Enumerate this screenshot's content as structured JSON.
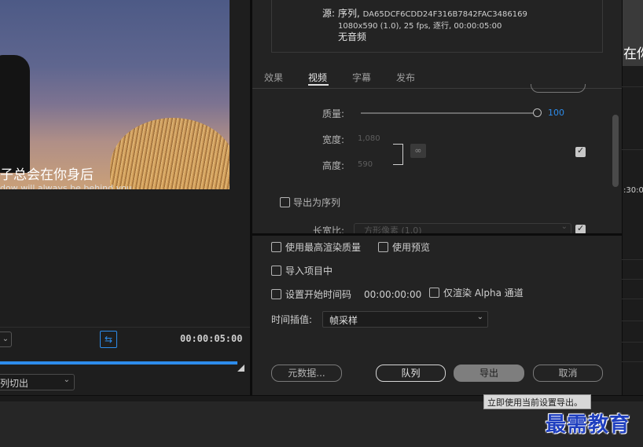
{
  "left_panel": {
    "subtitle_cn": "子总会在你身后",
    "subtitle_en": "dow will always be behind you",
    "duration": "00:00:05:00",
    "crop_dropdown": "列切出"
  },
  "source": {
    "label": "源:",
    "name_prefix": "序列,",
    "name_id": "DA65DCF6CDD24F316B7842FAC3486169",
    "details": "1080x590 (1.0), 25 fps, 逐行, 00:00:05:00",
    "audio": "无音频"
  },
  "tabs": [
    "效果",
    "视频",
    "字幕",
    "发布"
  ],
  "active_tab": "视频",
  "video": {
    "quality_label": "质量:",
    "quality_value": "100",
    "width_label": "宽度:",
    "width_value": "1,080",
    "height_label": "高度:",
    "height_value": "590",
    "export_sequence": "导出为序列",
    "aspect_label": "长宽比:",
    "aspect_value": "方形像素 (1.0)"
  },
  "options": {
    "max_render_quality": "使用最高渲染质量",
    "use_previews": "使用预览",
    "import_into_project": "导入项目中",
    "set_start_timecode": "设置开始时间码",
    "start_timecode_value": "00:00:00:00",
    "render_alpha_only": "仅渲染 Alpha 通道",
    "time_interp_label": "时间插值:",
    "time_interp_value": "帧采样"
  },
  "buttons": {
    "metadata": "元数据...",
    "queue": "队列",
    "export": "导出",
    "cancel": "取消"
  },
  "tooltip": "立即使用当前设置导出。",
  "far_right": {
    "text": "在你",
    "time": ":30:0"
  },
  "watermark": "最需教育",
  "colors": {
    "accent": "#2d8ceb",
    "background": "#232323",
    "watermark": "#1f3fbf"
  },
  "icons": {
    "link": "chain-link-icon",
    "fit": "fit-frame-icon",
    "dropdown": "chevron-down-icon"
  }
}
